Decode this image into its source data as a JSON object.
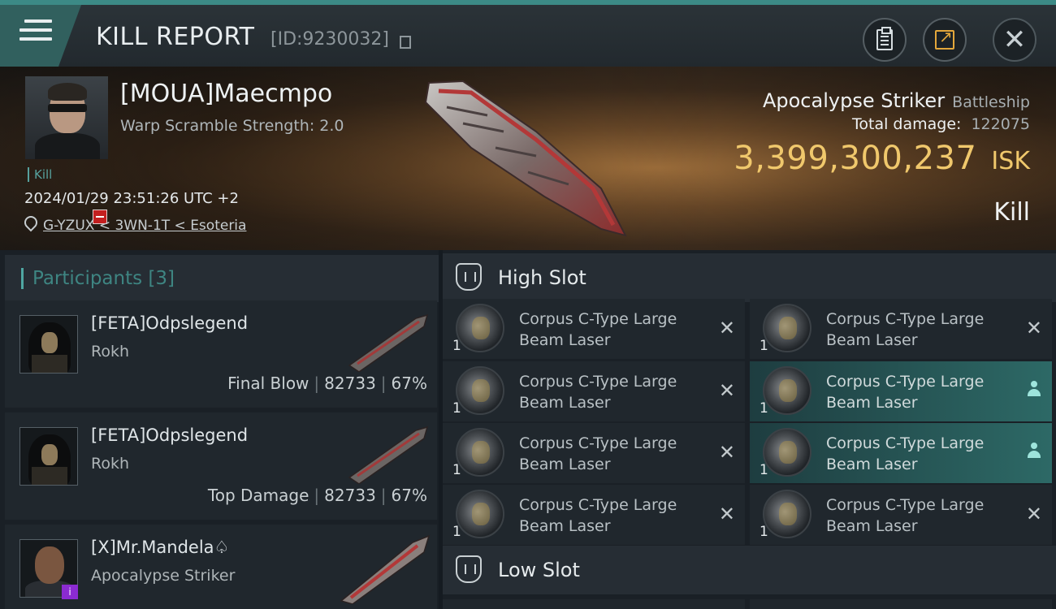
{
  "header": {
    "title": "KILL REPORT",
    "report_id": "[ID:9230032]",
    "icons": [
      "menu-icon",
      "copy-icon",
      "clipboard-icon",
      "share-icon",
      "close-icon"
    ]
  },
  "victim": {
    "pilot_name": "[MOUA]Maecmpo",
    "warp_scramble": "Warp Scramble Strength: 2.0",
    "tag": "Kill",
    "datetime": "2024/01/29 23:51:26 UTC +2",
    "location": "G-YZUX < 3WN-1T < Esoteria",
    "ship_name": "Apocalypse Striker",
    "ship_class": "Battleship",
    "total_damage_label": "Total damage:",
    "total_damage": "122075",
    "isk_value": "3,399,300,237",
    "isk_unit": "ISK",
    "result": "Kill"
  },
  "participants": {
    "header": "Participants [3]",
    "rows": [
      {
        "name": "[FETA]Odpslegend",
        "ship": "Rokh",
        "role": "Final Blow",
        "damage": "82733",
        "percent": "67%"
      },
      {
        "name": "[FETA]Odpslegend",
        "ship": "Rokh",
        "role": "Top Damage",
        "damage": "82733",
        "percent": "67%"
      },
      {
        "name": "[X]Mr.Mandela♤",
        "ship": "Apocalypse Striker",
        "badge": "i"
      }
    ]
  },
  "slots": {
    "high": {
      "title": "High Slot",
      "modules": [
        {
          "name": "Corpus C-Type Large Beam Laser",
          "qty": "1",
          "status": "destroyed"
        },
        {
          "name": "Corpus C-Type Large Beam Laser",
          "qty": "1",
          "status": "destroyed"
        },
        {
          "name": "Corpus C-Type Large Beam Laser",
          "qty": "1",
          "status": "destroyed"
        },
        {
          "name": "Corpus C-Type Large Beam Laser",
          "qty": "1",
          "status": "dropped"
        },
        {
          "name": "Corpus C-Type Large Beam Laser",
          "qty": "1",
          "status": "destroyed"
        },
        {
          "name": "Corpus C-Type Large Beam Laser",
          "qty": "1",
          "status": "dropped"
        },
        {
          "name": "Corpus C-Type Large Beam Laser",
          "qty": "1",
          "status": "destroyed"
        },
        {
          "name": "Corpus C-Type Large Beam Laser",
          "qty": "1",
          "status": "destroyed"
        }
      ]
    },
    "low": {
      "title": "Low Slot"
    }
  },
  "colors": {
    "accent": "#4fa7a2",
    "isk": "#f0c86c",
    "danger": "#c31f1f",
    "highlight": "#2d6966"
  }
}
